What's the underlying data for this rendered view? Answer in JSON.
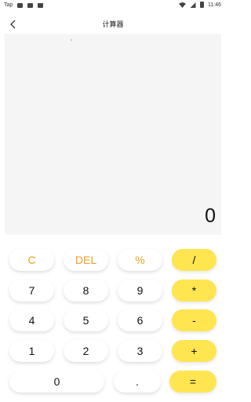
{
  "status_bar": {
    "app_label": "Tap",
    "time": "11:46",
    "icons": [
      "image-icon",
      "app-icon",
      "wifi-icon",
      "signal-icon",
      "battery-icon"
    ]
  },
  "header": {
    "title": "计算器",
    "back_icon": "chevron-left-icon"
  },
  "display": {
    "value": "0"
  },
  "keys": {
    "clear": "C",
    "delete": "DEL",
    "percent": "%",
    "divide": "/",
    "seven": "7",
    "eight": "8",
    "nine": "9",
    "multiply": "*",
    "four": "4",
    "five": "5",
    "six": "6",
    "minus": "-",
    "one": "1",
    "two": "2",
    "three": "3",
    "plus": "+",
    "zero": "0",
    "decimal": ".",
    "equals": "="
  },
  "colors": {
    "accent_yellow": "#ffe550",
    "operator_text": "#f0a020",
    "display_bg": "#f5f5f5"
  }
}
